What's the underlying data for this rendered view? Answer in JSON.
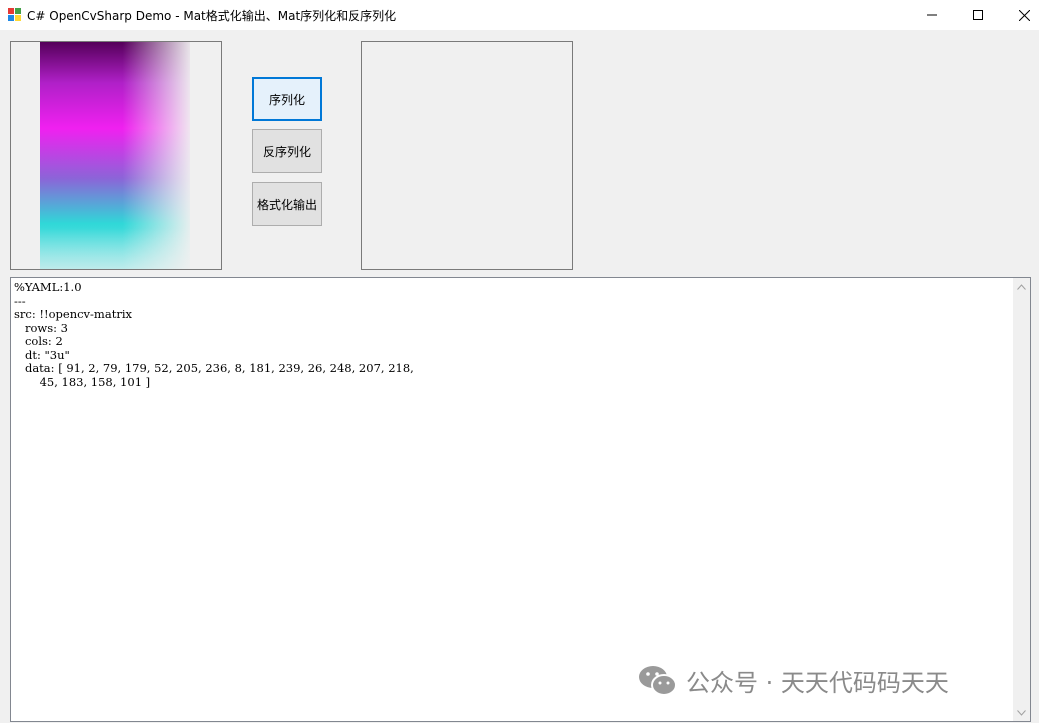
{
  "window": {
    "title": "C# OpenCvSharp Demo - Mat格式化输出、Mat序列化和反序列化",
    "icon": "app-icon",
    "controls": {
      "minimize_label": "–",
      "maximize_label": "☐",
      "close_label": "✕"
    }
  },
  "buttons": {
    "serialize_label": "序列化",
    "deserialize_label": "反序列化",
    "format_label": "格式化输出"
  },
  "output": {
    "text": "%YAML:1.0\n---\nsrc: !!opencv-matrix\n   rows: 3\n   cols: 2\n   dt: \"3u\"\n   data: [ 91, 2, 79, 179, 52, 205, 236, 8, 181, 239, 26, 248, 207, 218,\n       45, 183, 158, 101 ]"
  },
  "scrollbar": {
    "up_icon": "chevron-up-icon",
    "down_icon": "chevron-down-icon"
  },
  "watermark": {
    "text": "公众号 · 天天代码码天天"
  }
}
